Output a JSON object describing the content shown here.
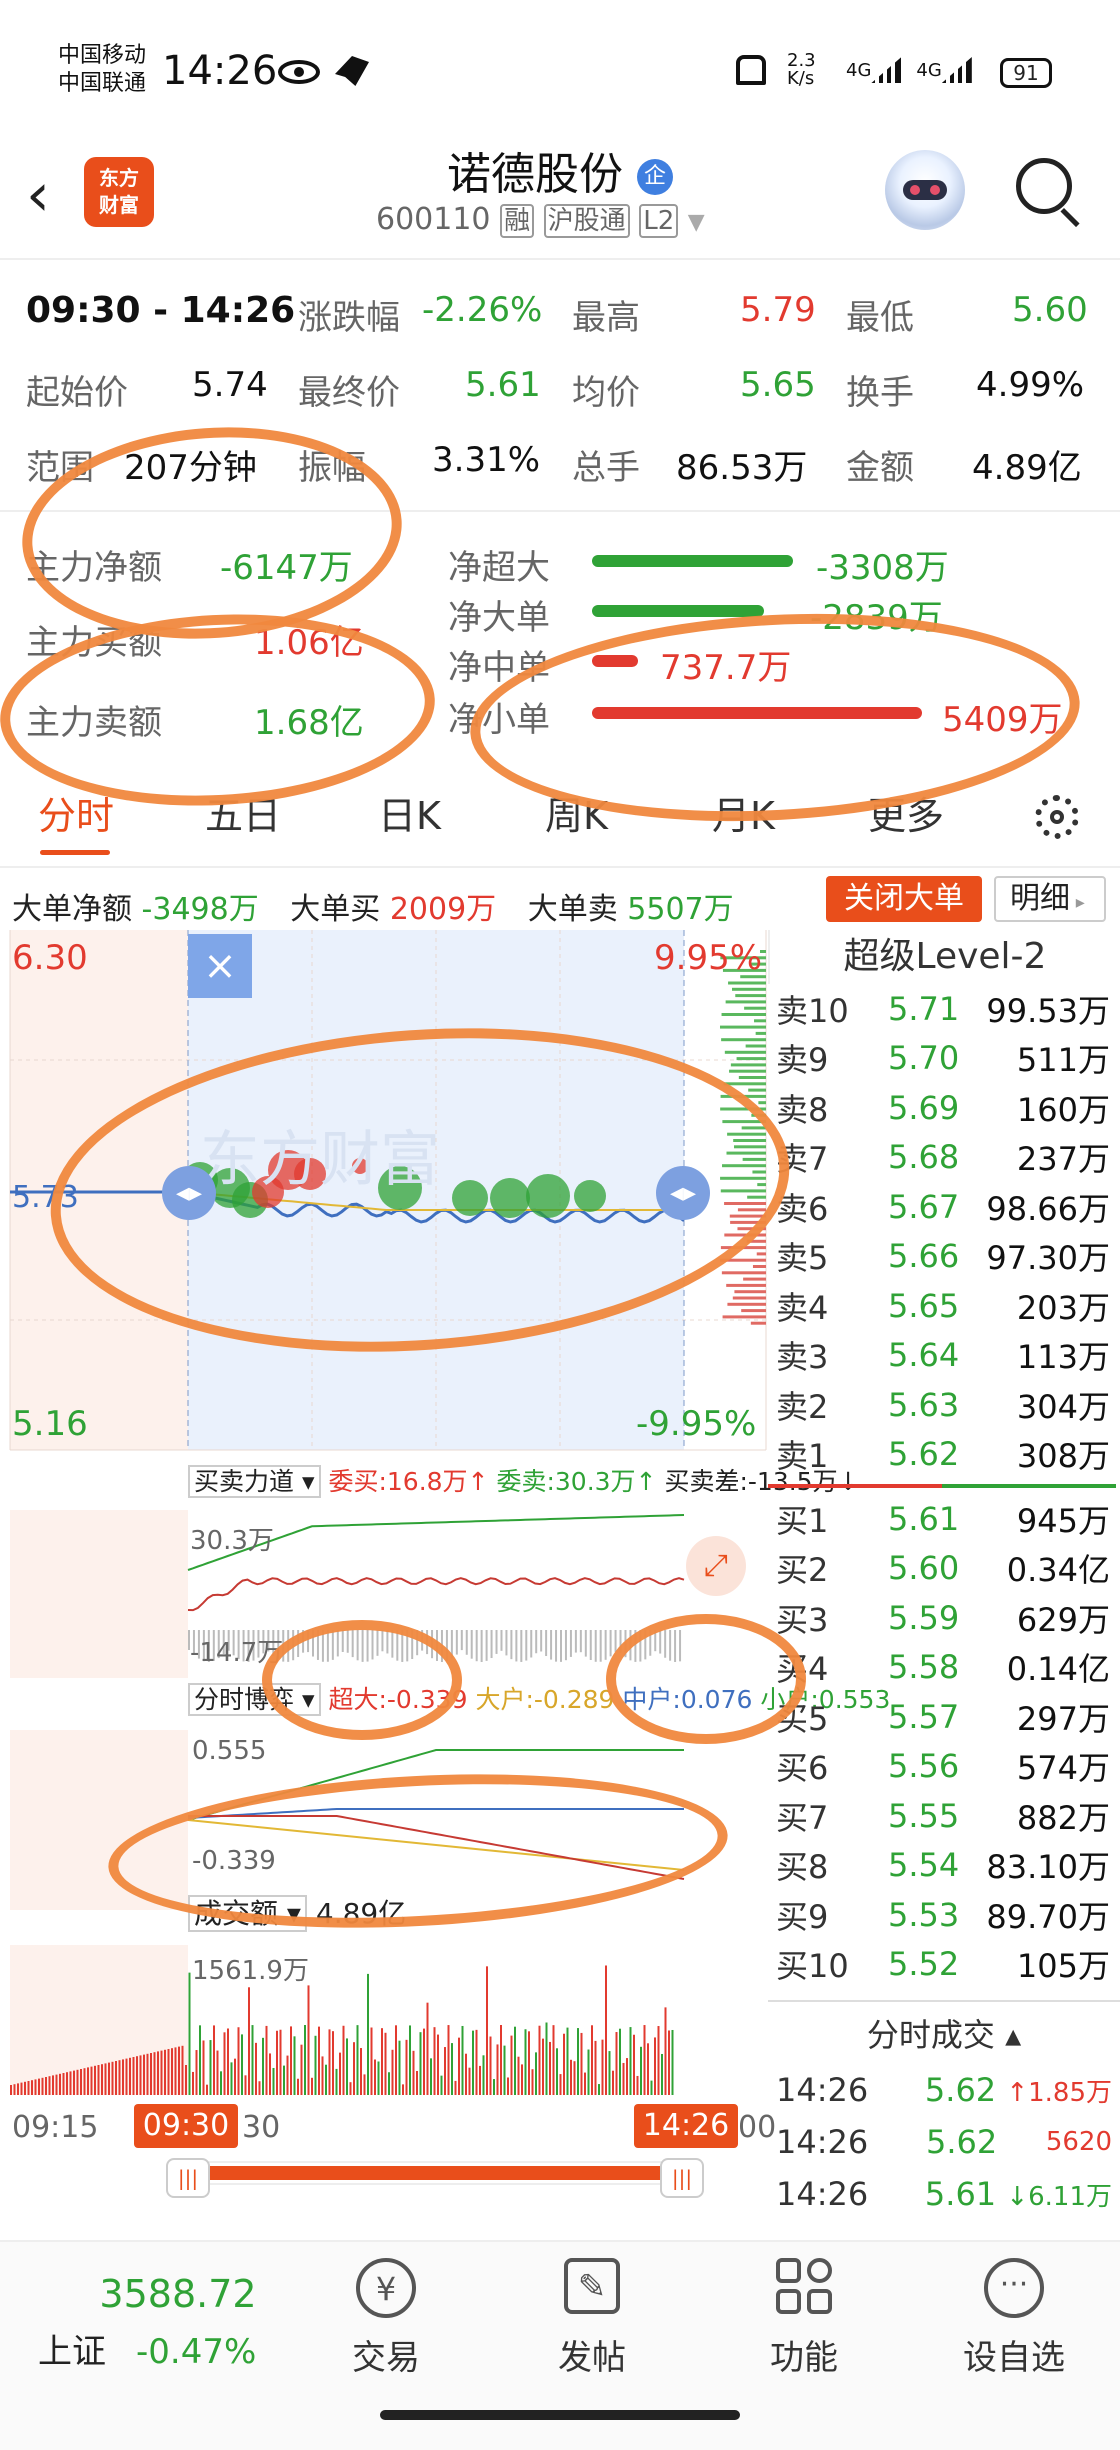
{
  "status_bar": {
    "carrier_1": "中国移动",
    "carrier_2": "中国联通",
    "time": "14:26",
    "net_speed": "2.3 K/s",
    "signal_1": "4G",
    "signal_2": "4G",
    "battery": "91"
  },
  "header": {
    "logo_line1": "东方",
    "logo_line2": "财富",
    "stock_name": "诺德股份",
    "enterprise_badge": "企",
    "stock_code": "600110",
    "tags": [
      "融",
      "沪股通",
      "L2"
    ]
  },
  "summary": {
    "time_range": "09:30 - 14:26",
    "rows": [
      [
        {
          "label": "涨跌幅",
          "value": "-2.26%",
          "color": "green"
        },
        {
          "label": "最高",
          "value": "5.79",
          "color": "red"
        },
        {
          "label": "最低",
          "value": "5.60",
          "color": "green"
        }
      ],
      [
        {
          "label": "起始价",
          "value": "5.74",
          "color": "dark"
        },
        {
          "label": "最终价",
          "value": "5.61",
          "color": "green"
        },
        {
          "label": "均价",
          "value": "5.65",
          "color": "green"
        },
        {
          "label": "换手",
          "value": "4.99%",
          "color": "dark"
        }
      ],
      [
        {
          "label": "范围",
          "value": "207分钟",
          "color": "dark"
        },
        {
          "label": "振幅",
          "value": "3.31%",
          "color": "dark"
        },
        {
          "label": "总手",
          "value": "86.53万",
          "color": "dark"
        },
        {
          "label": "金额",
          "value": "4.89亿",
          "color": "dark"
        }
      ]
    ]
  },
  "fund_flow": {
    "main_net_label": "主力净额",
    "main_net_value": "-6147万",
    "main_buy_label": "主力买额",
    "main_buy_value": "1.06亿",
    "main_sell_label": "主力卖额",
    "main_sell_value": "1.68亿",
    "bars": [
      {
        "label": "净超大",
        "value": "-3308万",
        "color": "#2fa236",
        "fraction": 0.61
      },
      {
        "label": "净大单",
        "value": "-2839万",
        "color": "#2fa236",
        "fraction": 0.52
      },
      {
        "label": "净中单",
        "value": "737.7万",
        "color": "#e23a2f",
        "fraction": 0.14
      },
      {
        "label": "净小单",
        "value": "5409万",
        "color": "#e23a2f",
        "fraction": 1.0
      }
    ]
  },
  "tabs": [
    "分时",
    "五日",
    "日K",
    "周K",
    "月K",
    "更多"
  ],
  "active_tab": "分时",
  "big_order": {
    "net_label": "大单净额",
    "net_value": "-3498万",
    "buy_label": "大单买",
    "buy_value": "2009万",
    "sell_label": "大单卖",
    "sell_value": "5507万",
    "close_button": "关闭大单",
    "detail_button": "明细"
  },
  "intraday": {
    "price_high": "6.30",
    "price_mid": "5.73",
    "price_low": "5.16",
    "pct_high": "9.95%",
    "pct_low": "-9.95%",
    "watermark": "东方财富",
    "bid_ask_label": "买卖力道",
    "bid_ask_buy": "委买:16.8万↑",
    "bid_ask_sell": "委卖:30.3万↑",
    "bid_ask_diff": "买卖差:-13.5万↓",
    "ba_top": "30.3万",
    "ba_bottom": "-14.7万",
    "game_label": "分时博弈",
    "game_super": "超大:-0.339",
    "game_large": "大户:-0.289",
    "game_mid": "中户:0.076",
    "game_small": "小户:0.553",
    "game_top": "0.555",
    "game_bottom": "-0.339",
    "volume_label": "成交额",
    "volume_value": "4.89亿",
    "volume_max": "1561.9万",
    "time_start": "09:15",
    "time_open": "09:30",
    "time_30": "30",
    "time_end": "14:26",
    "time_end_tail": "00"
  },
  "level2": {
    "title": "超级Level-2",
    "asks": [
      {
        "label": "卖10",
        "price": "5.71",
        "vol": "99.53万"
      },
      {
        "label": "卖9",
        "price": "5.70",
        "vol": "511万"
      },
      {
        "label": "卖8",
        "price": "5.69",
        "vol": "160万"
      },
      {
        "label": "卖7",
        "price": "5.68",
        "vol": "237万"
      },
      {
        "label": "卖6",
        "price": "5.67",
        "vol": "98.66万"
      },
      {
        "label": "卖5",
        "price": "5.66",
        "vol": "97.30万"
      },
      {
        "label": "卖4",
        "price": "5.65",
        "vol": "203万"
      },
      {
        "label": "卖3",
        "price": "5.64",
        "vol": "113万"
      },
      {
        "label": "卖2",
        "price": "5.63",
        "vol": "304万"
      },
      {
        "label": "卖1",
        "price": "5.62",
        "vol": "308万"
      }
    ],
    "bids": [
      {
        "label": "买1",
        "price": "5.61",
        "vol": "945万"
      },
      {
        "label": "买2",
        "price": "5.60",
        "vol": "0.34亿"
      },
      {
        "label": "买3",
        "price": "5.59",
        "vol": "629万"
      },
      {
        "label": "买4",
        "price": "5.58",
        "vol": "0.14亿"
      },
      {
        "label": "买5",
        "price": "5.57",
        "vol": "297万"
      },
      {
        "label": "买6",
        "price": "5.56",
        "vol": "574万"
      },
      {
        "label": "买7",
        "price": "5.55",
        "vol": "882万"
      },
      {
        "label": "买8",
        "price": "5.54",
        "vol": "83.10万"
      },
      {
        "label": "买9",
        "price": "5.53",
        "vol": "89.70万"
      },
      {
        "label": "买10",
        "price": "5.52",
        "vol": "105万"
      }
    ],
    "trades_title": "分时成交",
    "trades": [
      {
        "time": "14:26",
        "price": "5.62",
        "vol": "1.85万",
        "dir": "↑"
      },
      {
        "time": "14:26",
        "price": "5.62",
        "vol": "5620",
        "dir": ""
      },
      {
        "time": "14:26",
        "price": "5.61",
        "vol": "6.11万",
        "dir": "↓"
      }
    ]
  },
  "bottom_nav": {
    "index_value": "3588.72",
    "index_name": "上证",
    "index_change": "-0.47%",
    "items": [
      "交易",
      "发帖",
      "功能",
      "设自选"
    ]
  }
}
